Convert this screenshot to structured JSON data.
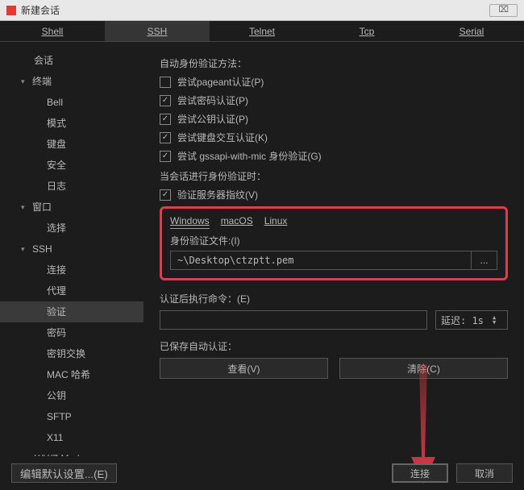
{
  "window": {
    "title": "新建会话",
    "close_glyph": "⌧"
  },
  "tabs": {
    "shell": "Shell",
    "ssh": "SSH",
    "telnet": "Telnet",
    "tcp": "Tcp",
    "serial": "Serial",
    "active": "ssh"
  },
  "sidebar": {
    "items": [
      {
        "id": "session",
        "label": "会话",
        "level": 0,
        "expandable": false
      },
      {
        "id": "terminal",
        "label": "终端",
        "level": 0,
        "expandable": true,
        "expanded": true
      },
      {
        "id": "bell",
        "label": "Bell",
        "level": 2
      },
      {
        "id": "mode",
        "label": "模式",
        "level": 2
      },
      {
        "id": "keyboard",
        "label": "键盘",
        "level": 2
      },
      {
        "id": "security",
        "label": "安全",
        "level": 2
      },
      {
        "id": "log",
        "label": "日志",
        "level": 2
      },
      {
        "id": "window",
        "label": "窗口",
        "level": 0,
        "expandable": true,
        "expanded": true
      },
      {
        "id": "select",
        "label": "选择",
        "level": 2
      },
      {
        "id": "ssh",
        "label": "SSH",
        "level": 0,
        "expandable": true,
        "expanded": true
      },
      {
        "id": "connect",
        "label": "连接",
        "level": 2
      },
      {
        "id": "proxy",
        "label": "代理",
        "level": 2
      },
      {
        "id": "auth",
        "label": "验证",
        "level": 2,
        "selected": true
      },
      {
        "id": "password",
        "label": "密码",
        "level": 2
      },
      {
        "id": "keyexchange",
        "label": "密钥交换",
        "level": 2
      },
      {
        "id": "machash",
        "label": "MAC 哈希",
        "level": 2
      },
      {
        "id": "pubkey",
        "label": "公钥",
        "level": 2
      },
      {
        "id": "sftp",
        "label": "SFTP",
        "level": 2
      },
      {
        "id": "x11",
        "label": "X11",
        "level": 2
      },
      {
        "id": "xyz",
        "label": "X/Y/Z Modem",
        "level": 0,
        "expandable": false
      }
    ]
  },
  "content": {
    "auth_method_label": "自动身份验证方法：",
    "checks": {
      "pageant": {
        "label": "尝试pageant认证(P)",
        "checked": false
      },
      "password": {
        "label": "尝试密码认证(P)",
        "checked": true
      },
      "pubkey": {
        "label": "尝试公钥认证(P)",
        "checked": true
      },
      "keyboard": {
        "label": "尝试键盘交互认证(K)",
        "checked": true
      },
      "gssapi": {
        "label": "尝试 gssapi-with-mic 身份验证(G)",
        "checked": true
      }
    },
    "when_auth_label": "当会话进行身份验证时：",
    "verify_fp": {
      "label": "验证服务器指纹(V)",
      "checked": true
    },
    "os_tabs": {
      "windows": "Windows",
      "macos": "macOS",
      "linux": "Linux",
      "active": "windows"
    },
    "id_file_label": "身份验证文件:(I)",
    "id_file_value": "~\\Desktop\\ctzptt.pem",
    "browse_label": "...",
    "post_cmd_label": "认证后执行命令：(E)",
    "post_cmd_value": "",
    "delay_label": "延迟: 1s",
    "saved_auth_label": "已保存自动认证：",
    "view_btn": "查看(V)",
    "clear_btn": "清除(C)"
  },
  "footer": {
    "edit_defaults": "编辑默认设置...(E)",
    "connect": "连接",
    "cancel": "取消"
  },
  "colors": {
    "accent_red": "#e23b4a"
  }
}
